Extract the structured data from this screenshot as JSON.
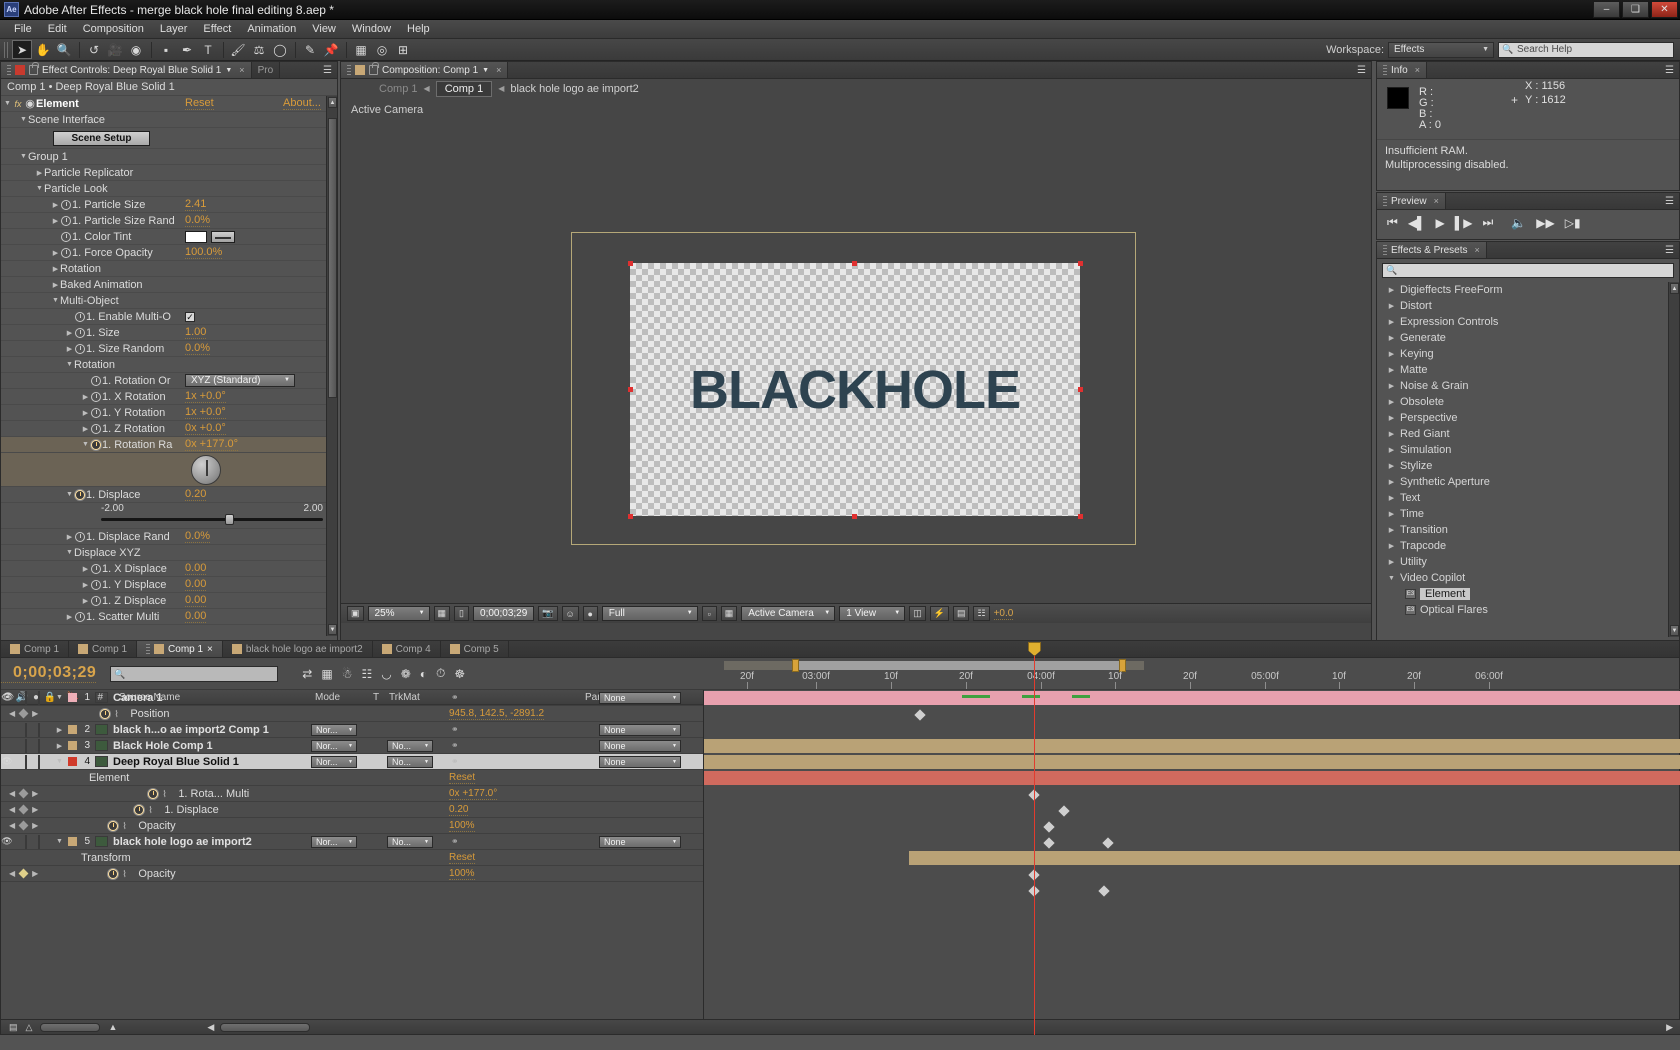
{
  "window": {
    "title": "Adobe After Effects - merge black hole final editing 8.aep *",
    "app_badge": "Ae",
    "minimize": "–",
    "maximize": "❑",
    "close": "✕"
  },
  "menu": {
    "items": [
      "File",
      "Edit",
      "Composition",
      "Layer",
      "Effect",
      "Animation",
      "View",
      "Window",
      "Help"
    ]
  },
  "toolbar": {
    "workspace_label": "Workspace:",
    "workspace_value": "Effects",
    "search_help_placeholder": "Search Help",
    "tools": [
      "selection-tool",
      "hand-tool",
      "zoom-tool",
      "rotation-tool",
      "camera-tool",
      "pan-behind-tool",
      "shape-tool",
      "pen-tool",
      "text-tool",
      "brush-tool",
      "clone-stamp-tool",
      "eraser-tool",
      "roto-brush-tool",
      "puppet-pin-tool"
    ]
  },
  "effect_controls": {
    "tab_label": "Effect Controls: Deep Royal Blue Solid 1",
    "tab_close": "×",
    "secondary_tab": "Pro",
    "breadcrumb": "Comp 1 • Deep Royal Blue Solid 1",
    "effect_name": "Element",
    "reset": "Reset",
    "about": "About...",
    "scene_interface": "Scene Interface",
    "scene_setup_button": "Scene Setup",
    "group": "Group 1",
    "particle_replicator": "Particle Replicator",
    "particle_look": "Particle Look",
    "rows": [
      {
        "label": "1. Particle Size",
        "value": "2.41"
      },
      {
        "label": "1. Particle Size Rand",
        "value": "0.0%"
      },
      {
        "label": "1. Color Tint",
        "value": ""
      },
      {
        "label": "1. Force Opacity",
        "value": "100.0%"
      }
    ],
    "rotation_group": "Rotation",
    "baked_animation": "Baked Animation",
    "multi_object": "Multi-Object",
    "multi_rows": [
      {
        "label": "1. Enable Multi-O",
        "value": ""
      },
      {
        "label": "1. Size",
        "value": "1.00"
      },
      {
        "label": "1. Size Random",
        "value": "0.0%"
      }
    ],
    "rotation_sub": "Rotation",
    "rotation_rows": [
      {
        "label": "1. Rotation Or",
        "value": "XYZ (Standard)"
      },
      {
        "label": "1. X Rotation",
        "value": "1x +0.0°"
      },
      {
        "label": "1. Y Rotation",
        "value": "1x +0.0°"
      },
      {
        "label": "1. Z Rotation",
        "value": "0x +0.0°"
      },
      {
        "label": "1. Rotation Ra",
        "value": "0x +177.0°"
      }
    ],
    "displace": {
      "label": "1. Displace",
      "value": "0.20",
      "min": "-2.00",
      "max": "2.00"
    },
    "displace_rand": {
      "label": "1. Displace Rand",
      "value": "0.0%"
    },
    "displace_xyz": "Displace XYZ",
    "xyz_rows": [
      {
        "label": "1. X Displace",
        "value": "0.00"
      },
      {
        "label": "1. Y Displace",
        "value": "0.00"
      },
      {
        "label": "1. Z Displace",
        "value": "0.00"
      },
      {
        "label": "1. Scatter Multi",
        "value": "0.00"
      }
    ]
  },
  "composition": {
    "tab_label": "Composition: Comp 1",
    "tab_close": "×",
    "crumbs": [
      "Comp 1",
      "Comp 1",
      "black hole logo ae import2"
    ],
    "active_camera_label": "Active Camera",
    "logo_text": "BLACKHOLE",
    "viewer_toolbar": {
      "zoom": "25%",
      "timecode": "0;00;03;29",
      "resolution": "Full",
      "camera": "Active Camera",
      "views": "1 View",
      "exposure": "+0.0"
    }
  },
  "info": {
    "tab_label": "Info",
    "tab_close": "×",
    "r": "R :",
    "g": "G :",
    "b": "B :",
    "a": "A : 0",
    "x": "X : 1156",
    "y": "Y : 1612",
    "message_line1": "Insufficient RAM.",
    "message_line2": "Multiprocessing disabled."
  },
  "preview": {
    "tab_label": "Preview",
    "tab_close": "×",
    "buttons": [
      "first-frame",
      "previous-frame",
      "play",
      "next-frame",
      "last-frame",
      "audio",
      "ram-preview"
    ]
  },
  "effects_presets": {
    "tab_label": "Effects & Presets",
    "tab_close": "×",
    "search_placeholder": "",
    "categories": [
      "Digieffects FreeForm",
      "Distort",
      "Expression Controls",
      "Generate",
      "Keying",
      "Matte",
      "Noise & Grain",
      "Obsolete",
      "Perspective",
      "Red Giant",
      "Simulation",
      "Stylize",
      "Synthetic Aperture",
      "Text",
      "Time",
      "Transition",
      "Trapcode",
      "Utility"
    ],
    "expanded_category": "Video Copilot",
    "expanded_items": [
      "Element",
      "Optical Flares"
    ],
    "selected_item": "Element"
  },
  "timeline": {
    "tabs": [
      {
        "label": "Comp 1",
        "active": false
      },
      {
        "label": "Comp 1",
        "active": false
      },
      {
        "label": "Comp 1",
        "active": true
      },
      {
        "label": "black hole logo ae import2",
        "active": false
      },
      {
        "label": "Comp 4",
        "active": false
      },
      {
        "label": "Comp 5",
        "active": false
      }
    ],
    "current_time": "0;00;03;29",
    "search_placeholder": "",
    "columns": [
      "#",
      "Source Name",
      "Mode",
      "T",
      "TrkMat",
      "Parent"
    ],
    "ruler_labels": [
      {
        "text": "20f",
        "pos": 43
      },
      {
        "text": "03:00f",
        "pos": 112
      },
      {
        "text": "10f",
        "pos": 187
      },
      {
        "text": "20f",
        "pos": 262
      },
      {
        "text": "04:00f",
        "pos": 337
      },
      {
        "text": "10f",
        "pos": 411
      },
      {
        "text": "20f",
        "pos": 486
      },
      {
        "text": "05:00f",
        "pos": 561
      },
      {
        "text": "10f",
        "pos": 635
      },
      {
        "text": "20f",
        "pos": 710
      },
      {
        "text": "06:00f",
        "pos": 785
      }
    ],
    "layers": [
      {
        "index": "1",
        "name": "Camera 1",
        "color": "#eeafb8",
        "mode": "",
        "trkmat": "",
        "parent": "None",
        "selected": false,
        "visible": true
      },
      {
        "index": "2",
        "name": "black h...o ae import2 Comp 1",
        "color": "#c8a876",
        "mode": "Nor...",
        "trkmat": "",
        "parent": "None",
        "selected": false,
        "visible": false
      },
      {
        "index": "3",
        "name": "Black Hole Comp 1",
        "color": "#c8a876",
        "mode": "Nor...",
        "trkmat": "No...",
        "parent": "None",
        "selected": false,
        "visible": false
      },
      {
        "index": "4",
        "name": "Deep Royal Blue Solid 1",
        "color": "#d03a2a",
        "mode": "Nor...",
        "trkmat": "No...",
        "parent": "None",
        "selected": true,
        "visible": true
      },
      {
        "index": "5",
        "name": "black hole logo ae import2",
        "color": "#c8a876",
        "mode": "Nor...",
        "trkmat": "No...",
        "parent": "None",
        "selected": false,
        "visible": true
      }
    ],
    "properties": [
      {
        "name": "Position",
        "value": "945.8, 142.5, -2891.2",
        "indent": 62
      },
      {
        "name": "Element",
        "value": "Reset",
        "indent": 46
      },
      {
        "name": "1. Rota... Multi",
        "value": "0x +177.0°",
        "indent": 110
      },
      {
        "name": "1. Displace",
        "value": "0.20",
        "indent": 96
      },
      {
        "name": "Opacity",
        "value": "100%",
        "indent": 70
      },
      {
        "name": "Transform",
        "value": "Reset",
        "indent": 38
      },
      {
        "name": "Opacity",
        "value": "100%",
        "indent": 70
      }
    ]
  }
}
